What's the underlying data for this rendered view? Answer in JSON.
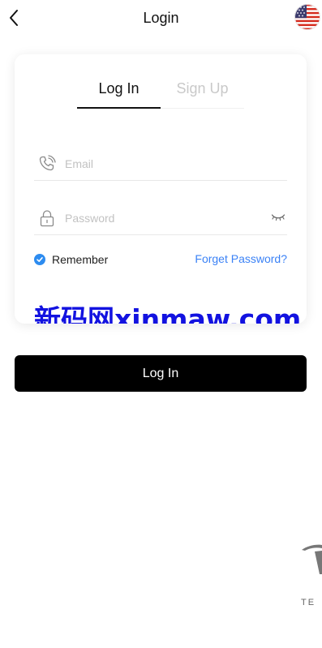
{
  "header": {
    "title": "Login",
    "back_icon": "chevron-left-icon",
    "language_flag": "us-flag-icon"
  },
  "tabs": [
    {
      "label": "Log In",
      "active": true
    },
    {
      "label": "Sign Up",
      "active": false
    }
  ],
  "form": {
    "email": {
      "placeholder": "Email",
      "value": "",
      "icon": "phone-icon"
    },
    "password": {
      "placeholder": "Password",
      "value": "",
      "icon": "lock-icon",
      "toggle_icon": "eye-closed-icon"
    },
    "remember": {
      "label": "Remember",
      "checked": true
    },
    "forgot_label": "Forget Password?"
  },
  "watermark": "新码网xinmaw.com",
  "submit_label": "Log In",
  "brand": {
    "text": "TE"
  },
  "colors": {
    "accent": "#3b82f6",
    "check": "#2d8cf0",
    "button_bg": "#000000",
    "watermark": "#1212e0"
  }
}
